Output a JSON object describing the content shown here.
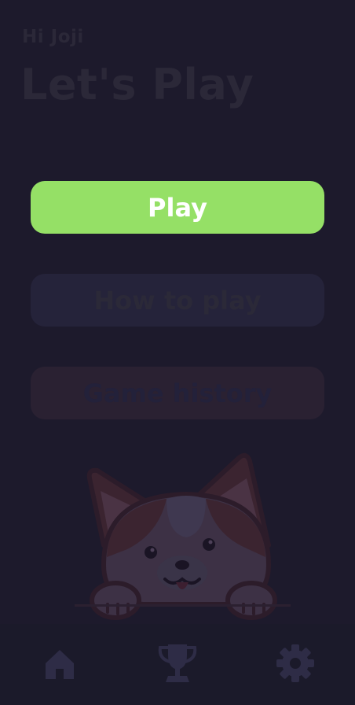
{
  "header": {
    "greeting": "Hi Joji",
    "title": "Let's Play"
  },
  "menu": {
    "play_label": "Play",
    "how_to_play_label": "How to play",
    "game_history_label": "Game history"
  },
  "illustration": {
    "icon": "corgi-dog-illustration"
  },
  "bottom_nav": {
    "items": [
      {
        "icon": "home-icon"
      },
      {
        "icon": "trophy-icon"
      },
      {
        "icon": "gear-icon"
      }
    ]
  },
  "colors": {
    "background": "#1d1a2c",
    "primary_button": "#95e066",
    "secondary_button": "#25233a",
    "tertiary_button": "#2a2132",
    "nav_icon": "#2e2c46"
  }
}
